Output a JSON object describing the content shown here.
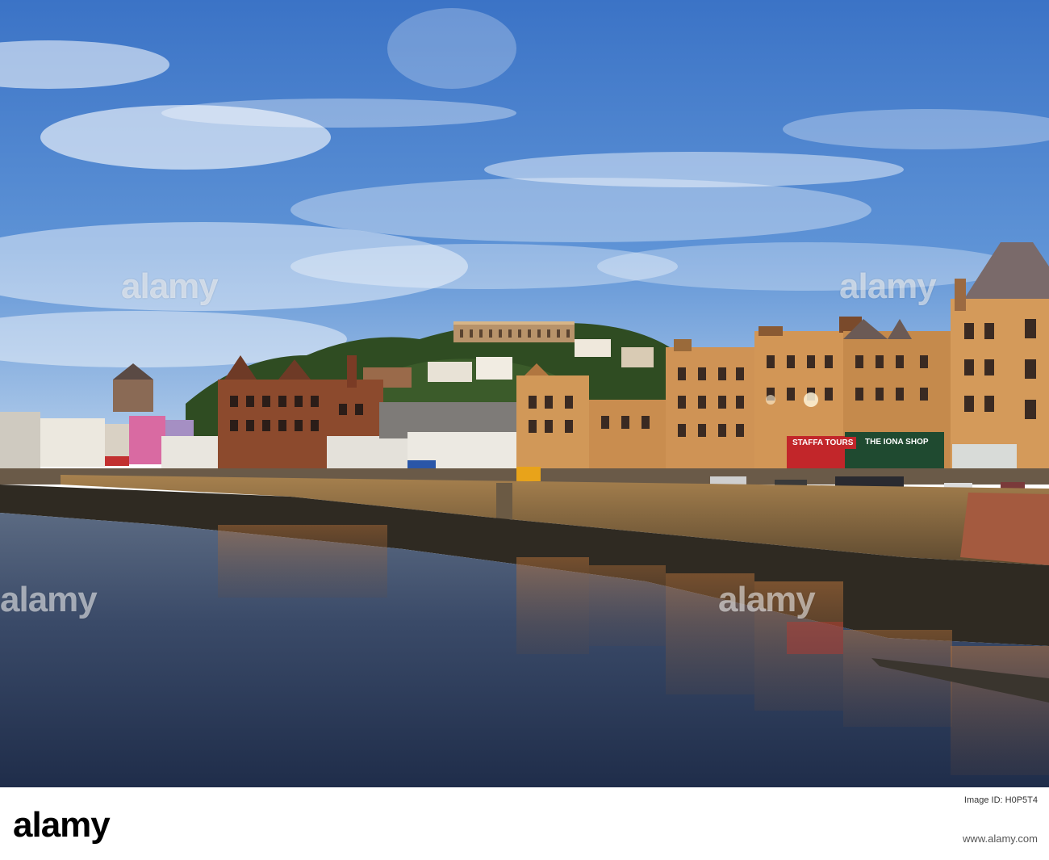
{
  "watermark": {
    "brand": "alamy"
  },
  "shop_signs": {
    "staffa": "STAFFA TOURS",
    "iona": "THE IONA SHOP"
  },
  "footer": {
    "brand": "alamy",
    "image_id": "Image ID: H0P5T4",
    "url": "www.alamy.com"
  },
  "colors": {
    "sky_top": "#3d77c9",
    "sky_bottom": "#a9c9ec",
    "sandstone": "#c98c4e",
    "red_sandstone": "#8f4a2e",
    "hill_green": "#2c4a1f",
    "water": "#3b4d6b"
  }
}
